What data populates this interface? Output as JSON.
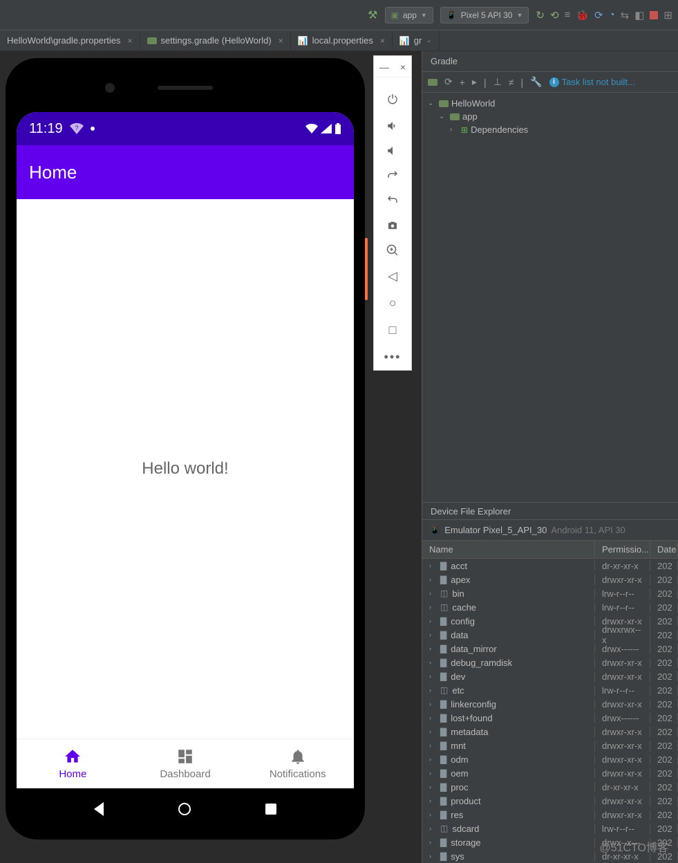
{
  "ide": {
    "toolbar": {
      "run_config": "app",
      "device": "Pixel 5 API 30"
    },
    "tabs": [
      {
        "label": "HelloWorld\\gradle.properties"
      },
      {
        "label": "settings.gradle (HelloWorld)"
      },
      {
        "label": "local.properties"
      },
      {
        "label": "gr"
      }
    ]
  },
  "gradle": {
    "title": "Gradle",
    "task_msg": "Task list not built...",
    "tree": {
      "root": "HelloWorld",
      "child": "app",
      "leaf": "Dependencies"
    }
  },
  "emulator": {
    "status_time": "11:19",
    "app_bar_title": "Home",
    "content_text": "Hello world!",
    "nav": [
      {
        "label": "Home",
        "active": true
      },
      {
        "label": "Dashboard",
        "active": false
      },
      {
        "label": "Notifications",
        "active": false
      }
    ]
  },
  "dfe": {
    "title": "Device File Explorer",
    "device_name": "Emulator Pixel_5_API_30",
    "device_os": "Android 11, API 30",
    "columns": {
      "name": "Name",
      "perm": "Permissio...",
      "date": "Date"
    },
    "rows": [
      {
        "name": "acct",
        "perm": "dr-xr-xr-x",
        "date": "202"
      },
      {
        "name": "apex",
        "perm": "drwxr-xr-x",
        "date": "202"
      },
      {
        "name": "bin",
        "perm": "lrw-r--r--",
        "date": "202",
        "link": true
      },
      {
        "name": "cache",
        "perm": "lrw-r--r--",
        "date": "202",
        "link": true
      },
      {
        "name": "config",
        "perm": "drwxr-xr-x",
        "date": "202"
      },
      {
        "name": "data",
        "perm": "drwxrwx--x",
        "date": "202"
      },
      {
        "name": "data_mirror",
        "perm": "drwx------",
        "date": "202"
      },
      {
        "name": "debug_ramdisk",
        "perm": "drwxr-xr-x",
        "date": "202"
      },
      {
        "name": "dev",
        "perm": "drwxr-xr-x",
        "date": "202"
      },
      {
        "name": "etc",
        "perm": "lrw-r--r--",
        "date": "202",
        "link": true
      },
      {
        "name": "linkerconfig",
        "perm": "drwxr-xr-x",
        "date": "202"
      },
      {
        "name": "lost+found",
        "perm": "drwx------",
        "date": "202"
      },
      {
        "name": "metadata",
        "perm": "drwxr-xr-x",
        "date": "202"
      },
      {
        "name": "mnt",
        "perm": "drwxr-xr-x",
        "date": "202"
      },
      {
        "name": "odm",
        "perm": "drwxr-xr-x",
        "date": "202"
      },
      {
        "name": "oem",
        "perm": "drwxr-xr-x",
        "date": "202"
      },
      {
        "name": "proc",
        "perm": "dr-xr-xr-x",
        "date": "202"
      },
      {
        "name": "product",
        "perm": "drwxr-xr-x",
        "date": "202"
      },
      {
        "name": "res",
        "perm": "drwxr-xr-x",
        "date": "202"
      },
      {
        "name": "sdcard",
        "perm": "lrw-r--r--",
        "date": "202",
        "link": true
      },
      {
        "name": "storage",
        "perm": "drwx--x---",
        "date": "202"
      },
      {
        "name": "sys",
        "perm": "dr-xr-xr-x",
        "date": "202"
      }
    ]
  },
  "watermark": "@51CTO博客"
}
